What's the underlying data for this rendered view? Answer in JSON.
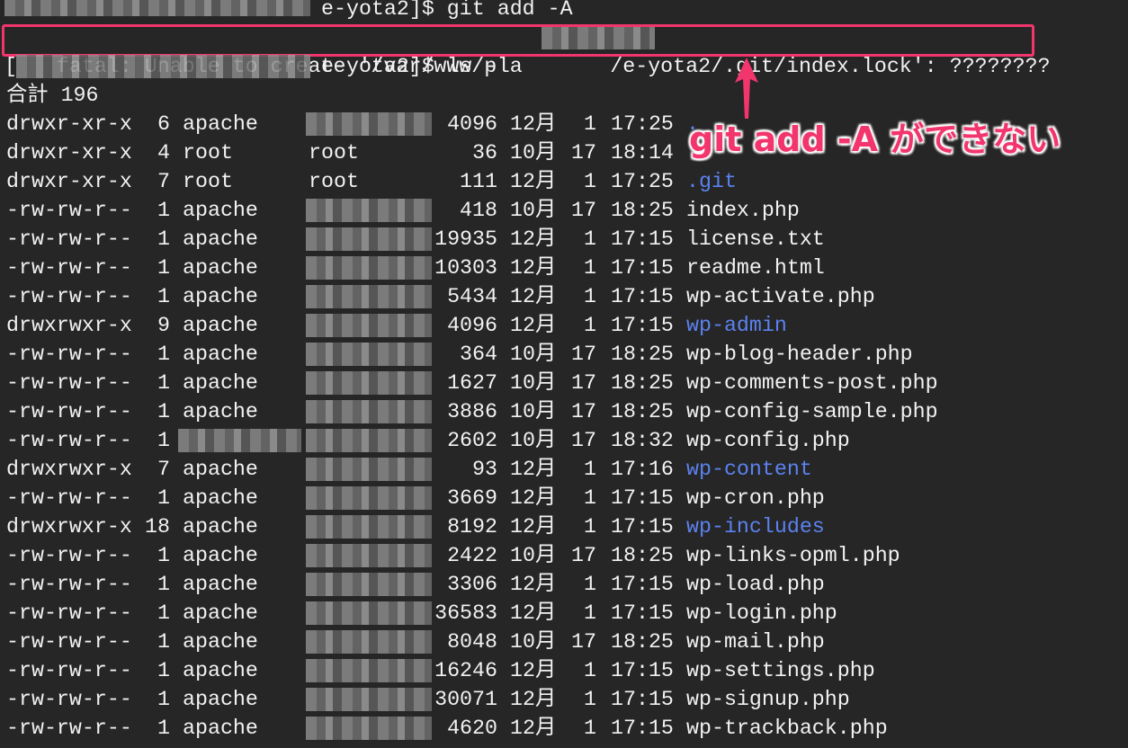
{
  "prompt1": {
    "suffix": "e-yota2]$ git add -A"
  },
  "error": {
    "prefix": "fatal: Unable to create '/var/www/p",
    "suffix": "/e-yota2/.git/index.lock': ????????"
  },
  "prompt2": {
    "prefix": "[",
    "suffix": "e-yota2]$ ls -la"
  },
  "total": "合計 196",
  "annotation": "git add -A ができない",
  "colors": {
    "background": "#262626",
    "text": "#f2f2f2",
    "directory": "#5b82f0",
    "annotation": "#f2356d"
  },
  "rows": [
    {
      "perm": "drwxr-xr-x",
      "links": "6",
      "owner": "apache",
      "group": "",
      "size": "4096",
      "month": "12月",
      "day": "1",
      "time": "17:25",
      "name": ".",
      "dir": true,
      "gblur": true
    },
    {
      "perm": "drwxr-xr-x",
      "links": "4",
      "owner": "root",
      "group": "root",
      "size": "36",
      "month": "10月",
      "day": "17",
      "time": "18:14",
      "name": "..",
      "dir": true
    },
    {
      "perm": "drwxr-xr-x",
      "links": "7",
      "owner": "root",
      "group": "root",
      "size": "111",
      "month": "12月",
      "day": "1",
      "time": "17:25",
      "name": ".git",
      "dir": true
    },
    {
      "perm": "-rw-rw-r--",
      "links": "1",
      "owner": "apache",
      "size": "418",
      "month": "10月",
      "day": "17",
      "time": "18:25",
      "name": "index.php",
      "gblur": true
    },
    {
      "perm": "-rw-rw-r--",
      "links": "1",
      "owner": "apache",
      "size": "19935",
      "month": "12月",
      "day": "1",
      "time": "17:15",
      "name": "license.txt",
      "gblur": true
    },
    {
      "perm": "-rw-rw-r--",
      "links": "1",
      "owner": "apache",
      "size": "10303",
      "month": "12月",
      "day": "1",
      "time": "17:15",
      "name": "readme.html",
      "gblur": true
    },
    {
      "perm": "-rw-rw-r--",
      "links": "1",
      "owner": "apache",
      "size": "5434",
      "month": "12月",
      "day": "1",
      "time": "17:15",
      "name": "wp-activate.php",
      "gblur": true
    },
    {
      "perm": "drwxrwxr-x",
      "links": "9",
      "owner": "apache",
      "size": "4096",
      "month": "12月",
      "day": "1",
      "time": "17:15",
      "name": "wp-admin",
      "dir": true,
      "gblur": true
    },
    {
      "perm": "-rw-rw-r--",
      "links": "1",
      "owner": "apache",
      "size": "364",
      "month": "10月",
      "day": "17",
      "time": "18:25",
      "name": "wp-blog-header.php",
      "gblur": true
    },
    {
      "perm": "-rw-rw-r--",
      "links": "1",
      "owner": "apache",
      "size": "1627",
      "month": "10月",
      "day": "17",
      "time": "18:25",
      "name": "wp-comments-post.php",
      "gblur": true
    },
    {
      "perm": "-rw-rw-r--",
      "links": "1",
      "owner": "apache",
      "size": "3886",
      "month": "10月",
      "day": "17",
      "time": "18:25",
      "name": "wp-config-sample.php",
      "gblur": true
    },
    {
      "perm": "-rw-rw-r--",
      "links": "1",
      "owner": "",
      "size": "2602",
      "month": "10月",
      "day": "17",
      "time": "18:32",
      "name": "wp-config.php",
      "oblur": true,
      "gblur": true
    },
    {
      "perm": "drwxrwxr-x",
      "links": "7",
      "owner": "apache",
      "size": "93",
      "month": "12月",
      "day": "1",
      "time": "17:16",
      "name": "wp-content",
      "dir": true,
      "gblur": true
    },
    {
      "perm": "-rw-rw-r--",
      "links": "1",
      "owner": "apache",
      "size": "3669",
      "month": "12月",
      "day": "1",
      "time": "17:15",
      "name": "wp-cron.php",
      "gblur": true
    },
    {
      "perm": "drwxrwxr-x",
      "links": "18",
      "owner": "apache",
      "size": "8192",
      "month": "12月",
      "day": "1",
      "time": "17:15",
      "name": "wp-includes",
      "dir": true,
      "gblur": true
    },
    {
      "perm": "-rw-rw-r--",
      "links": "1",
      "owner": "apache",
      "size": "2422",
      "month": "10月",
      "day": "17",
      "time": "18:25",
      "name": "wp-links-opml.php",
      "gblur": true
    },
    {
      "perm": "-rw-rw-r--",
      "links": "1",
      "owner": "apache",
      "size": "3306",
      "month": "12月",
      "day": "1",
      "time": "17:15",
      "name": "wp-load.php",
      "gblur": true
    },
    {
      "perm": "-rw-rw-r--",
      "links": "1",
      "owner": "apache",
      "size": "36583",
      "month": "12月",
      "day": "1",
      "time": "17:15",
      "name": "wp-login.php",
      "gblur": true
    },
    {
      "perm": "-rw-rw-r--",
      "links": "1",
      "owner": "apache",
      "size": "8048",
      "month": "10月",
      "day": "17",
      "time": "18:25",
      "name": "wp-mail.php",
      "gblur": true
    },
    {
      "perm": "-rw-rw-r--",
      "links": "1",
      "owner": "apache",
      "size": "16246",
      "month": "12月",
      "day": "1",
      "time": "17:15",
      "name": "wp-settings.php",
      "gblur": true
    },
    {
      "perm": "-rw-rw-r--",
      "links": "1",
      "owner": "apache",
      "size": "30071",
      "month": "12月",
      "day": "1",
      "time": "17:15",
      "name": "wp-signup.php",
      "gblur": true
    },
    {
      "perm": "-rw-rw-r--",
      "links": "1",
      "owner": "apache",
      "size": "4620",
      "month": "12月",
      "day": "1",
      "time": "17:15",
      "name": "wp-trackback.php",
      "gblur": true
    }
  ]
}
